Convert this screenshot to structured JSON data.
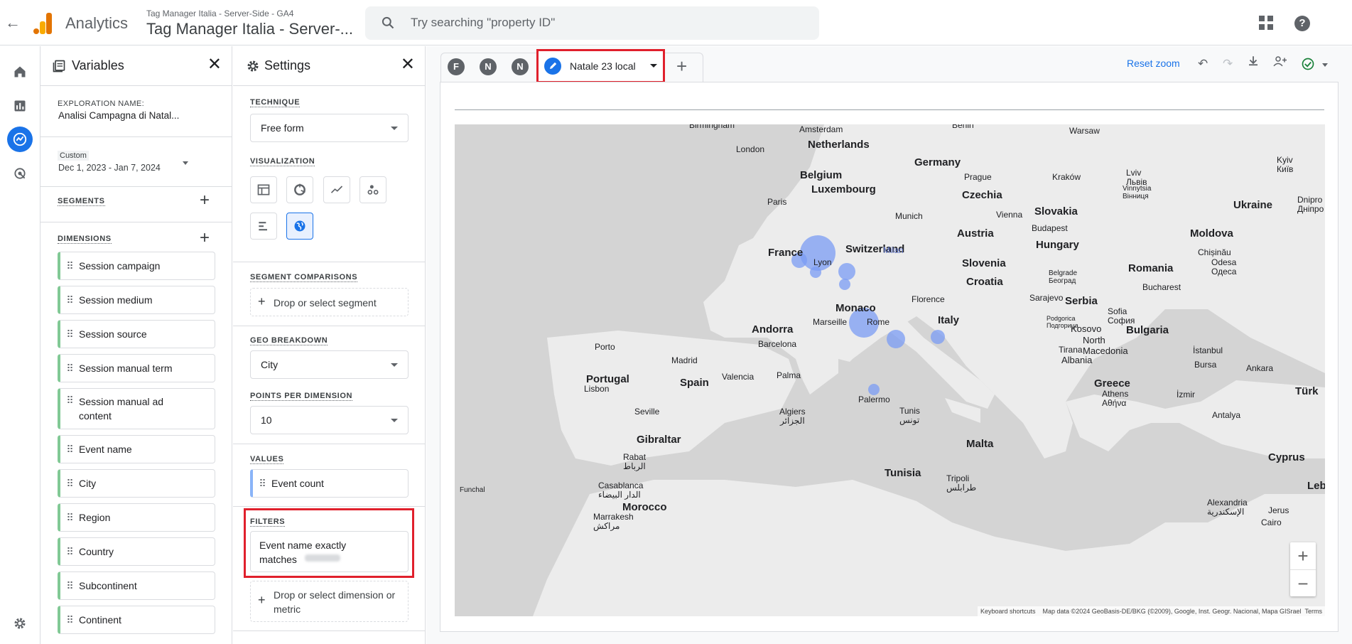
{
  "header": {
    "app_name": "Analytics",
    "account_sub": "Tag Manager Italia - Server-Side - GA4",
    "account_main": "Tag Manager Italia - Server-...",
    "search_placeholder": "Try searching \"property ID\""
  },
  "variables_panel": {
    "title": "Variables",
    "exploration_label": "EXPLORATION NAME:",
    "exploration_name": "Analisi Campagna di Natal...",
    "date_custom": "Custom",
    "date_range": "Dec 1, 2023 - Jan 7, 2024",
    "segments_label": "SEGMENTS",
    "dimensions_label": "DIMENSIONS",
    "dimensions": [
      "Session campaign",
      "Session medium",
      "Session source",
      "Session manual term",
      "Session manual ad content",
      "Event name",
      "City",
      "Region",
      "Country",
      "Subcontinent",
      "Continent"
    ]
  },
  "settings_panel": {
    "title": "Settings",
    "technique_label": "TECHNIQUE",
    "technique_value": "Free form",
    "visualization_label": "VISUALIZATION",
    "segment_comparisons_label": "SEGMENT COMPARISONS",
    "segment_drop": "Drop or select segment",
    "geo_breakdown_label": "GEO BREAKDOWN",
    "geo_breakdown_value": "City",
    "points_label": "POINTS PER DIMENSION",
    "points_value": "10",
    "values_label": "VALUES",
    "values_item": "Event count",
    "filters_label": "FILTERS",
    "filter_item": "Event name exactly matches",
    "filter_drop": "Drop or select dimension or metric"
  },
  "tabs": {
    "letters": [
      "F",
      "N",
      "N"
    ],
    "active_tab": "Natale 23 local"
  },
  "toolbar": {
    "reset_zoom": "Reset zoom"
  },
  "map": {
    "labels": {
      "birmingham": "Birmingham",
      "amsterdam": "Amsterdam",
      "berlin": "Berlin",
      "warsaw": "Warsaw",
      "london": "London",
      "netherlands": "Netherlands",
      "germany": "Germany",
      "belgium": "Belgium",
      "prague": "Prague",
      "krakow": "Kraków",
      "lviv": "Lviv\nЛьвів",
      "kyiv": "Kyiv\nКиїв",
      "luxembourg": "Luxembourg",
      "czechia": "Czechia",
      "vinnytsia": "Vinnytsia\nВінниця",
      "dnipro": "Dnipro\nДніпро",
      "paris": "Paris",
      "ukraine": "Ukraine",
      "munich": "Munich",
      "vienna": "Vienna",
      "slovakia": "Slovakia",
      "budapest": "Budapest",
      "austria": "Austria",
      "moldova": "Moldova",
      "switzerland": "Switzerland",
      "hungary": "Hungary",
      "chisinau": "Chișinău",
      "france": "France",
      "lyon": "Lyon",
      "milan": "Milan",
      "slovenia": "Slovenia",
      "odesa": "Odesa\nОдеса",
      "romania": "Romania",
      "belgrade": "Belgrade\nБеоград",
      "croatia": "Croatia",
      "bucharest": "Bucharest",
      "florence": "Florence",
      "sarajevo": "Sarajevo",
      "serbia": "Serbia",
      "monaco": "Monaco",
      "italy": "Italy",
      "marseille": "Marseille",
      "podgorica": "Podgorica\nПодгорица",
      "sofia": "Sofia\nСофия",
      "andorra": "Andorra",
      "kosovo": "Kosovo",
      "bulgaria": "Bulgaria",
      "rome": "Rome",
      "north_macedonia": "North\nMacedonia",
      "barcelona": "Barcelona",
      "porto": "Porto",
      "tirana": "Tirana",
      "istanbul": "İstanbul",
      "madrid": "Madrid",
      "albania": "Albania",
      "bursa": "Bursa",
      "ankara": "Ankara",
      "portugal": "Portugal",
      "valencia": "Valencia",
      "palma": "Palma",
      "lisbon": "Lisbon",
      "spain": "Spain",
      "greece": "Greece",
      "turkiye": "Türk",
      "izmir": "İzmir",
      "athens": "Athens\nΑθήνα",
      "palermo": "Palermo",
      "seville": "Seville",
      "algiers": "Algiers\nالجزائر",
      "tunis": "Tunis\nتونس",
      "antalya": "Antalya",
      "gibraltar": "Gibraltar",
      "malta": "Malta",
      "cyprus": "Cyprus",
      "rabat": "Rabat\nالرباط",
      "tunisia": "Tunisia",
      "tripoli": "Tripoli\nطرابلس",
      "funchal": "Funchal",
      "casablanca": "Casablanca\nالدار البيضاء",
      "alexandria": "Alexandria\nالإسكندرية",
      "morocco": "Morocco",
      "marrakesh": "Marrakesh\nمراكش",
      "jerus": "Jerus",
      "cairo": "Cairo",
      "leb": "Leb"
    },
    "footer_shortcuts": "Keyboard shortcuts",
    "footer_data": "Map data ©2024 GeoBasis-DE/BKG (©2009), Google, Inst. Geogr. Nacional, Mapa GISrael",
    "footer_terms": "Terms"
  },
  "colors": {
    "accent": "#1a73e8",
    "highlight": "#e0202c",
    "bubble": "#7b9cf4",
    "dimension_stripe": "#81c995"
  }
}
